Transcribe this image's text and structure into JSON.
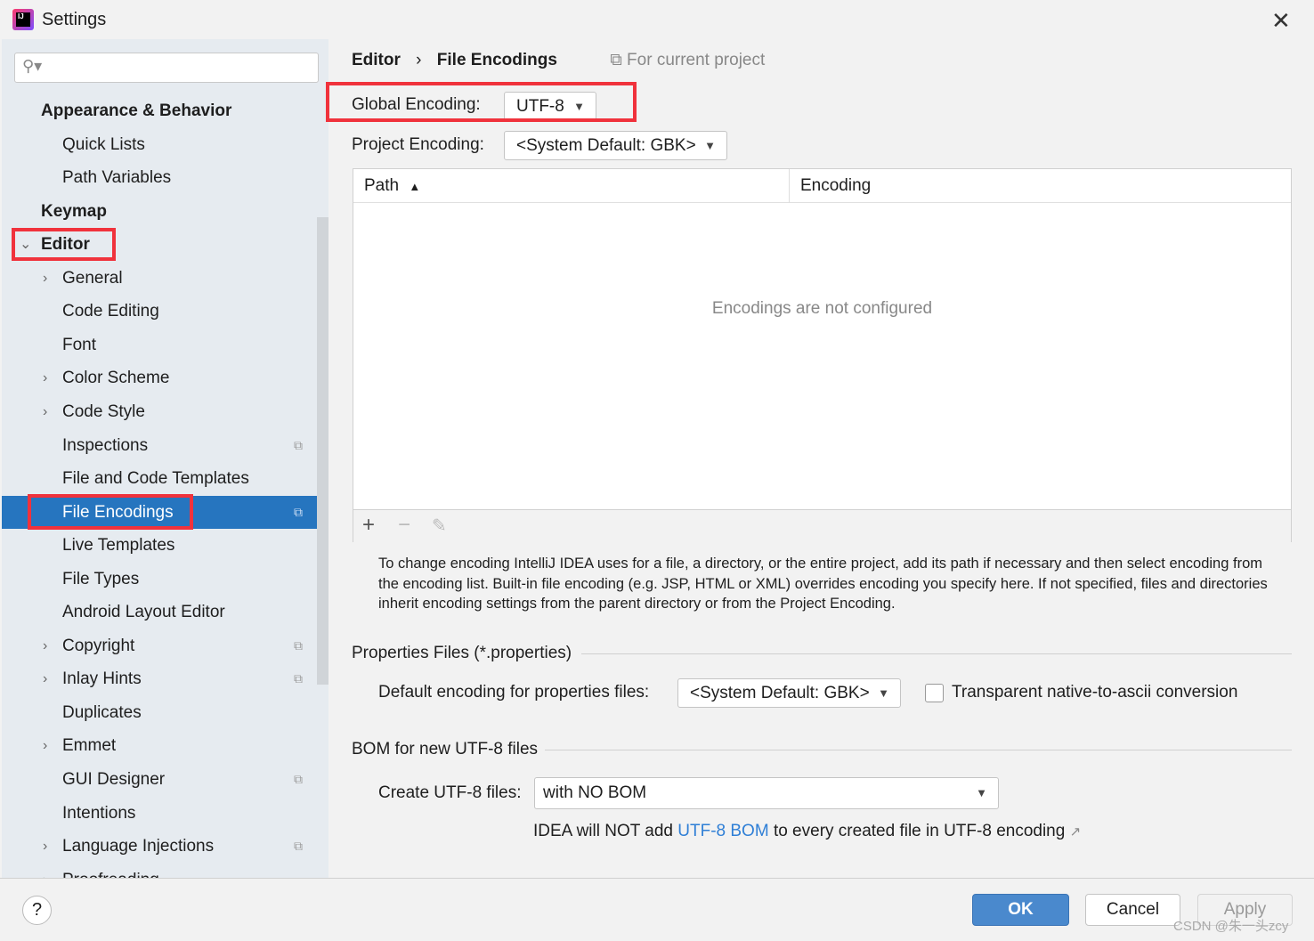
{
  "window": {
    "title": "Settings",
    "logo_text": "IJ"
  },
  "sidebar": {
    "search_placeholder": "",
    "items": [
      {
        "label": "Appearance & Behavior",
        "level": 0,
        "bold": true
      },
      {
        "label": "Quick Lists",
        "level": 1
      },
      {
        "label": "Path Variables",
        "level": 1
      },
      {
        "label": "Keymap",
        "level": 0,
        "bold": true
      },
      {
        "label": "Editor",
        "level": 0,
        "bold": true,
        "expanded": true
      },
      {
        "label": "General",
        "level": 1,
        "chevron": true
      },
      {
        "label": "Code Editing",
        "level": 1
      },
      {
        "label": "Font",
        "level": 1
      },
      {
        "label": "Color Scheme",
        "level": 1,
        "chevron": true
      },
      {
        "label": "Code Style",
        "level": 1,
        "chevron": true
      },
      {
        "label": "Inspections",
        "level": 1,
        "project": true
      },
      {
        "label": "File and Code Templates",
        "level": 1
      },
      {
        "label": "File Encodings",
        "level": 1,
        "project": true,
        "selected": true
      },
      {
        "label": "Live Templates",
        "level": 1
      },
      {
        "label": "File Types",
        "level": 1
      },
      {
        "label": "Android Layout Editor",
        "level": 1
      },
      {
        "label": "Copyright",
        "level": 1,
        "chevron": true,
        "project": true
      },
      {
        "label": "Inlay Hints",
        "level": 1,
        "chevron": true,
        "project": true
      },
      {
        "label": "Duplicates",
        "level": 1
      },
      {
        "label": "Emmet",
        "level": 1,
        "chevron": true
      },
      {
        "label": "GUI Designer",
        "level": 1,
        "project": true
      },
      {
        "label": "Intentions",
        "level": 1
      },
      {
        "label": "Language Injections",
        "level": 1,
        "chevron": true,
        "project": true
      },
      {
        "label": "Proofreading",
        "level": 1,
        "chevron": true
      }
    ]
  },
  "breadcrumb": {
    "parent": "Editor",
    "sep": "›",
    "current": "File Encodings",
    "scope": "For current project"
  },
  "global_encoding": {
    "label": "Global Encoding:",
    "value": "UTF-8"
  },
  "project_encoding": {
    "label": "Project Encoding:",
    "value": "<System Default: GBK>"
  },
  "table": {
    "columns": [
      "Path",
      "Encoding"
    ],
    "empty_text": "Encodings are not configured"
  },
  "help_text": "To change encoding IntelliJ IDEA uses for a file, a directory, or the entire project, add its path if necessary and then select encoding from the encoding list. Built-in file encoding (e.g. JSP, HTML or XML) overrides encoding you specify here. If not specified, files and directories inherit encoding settings from the parent directory or from the Project Encoding.",
  "properties": {
    "section": "Properties Files (*.properties)",
    "label": "Default encoding for properties files:",
    "value": "<System Default: GBK>",
    "checkbox_label": "Transparent native-to-ascii conversion",
    "checked": false
  },
  "bom": {
    "section": "BOM for new UTF-8 files",
    "label": "Create UTF-8 files:",
    "value": "with NO BOM",
    "note_before": "IDEA will NOT add",
    "note_link": "UTF-8 BOM",
    "note_after": "to every created file in UTF-8 encoding"
  },
  "footer": {
    "help": "?",
    "ok": "OK",
    "cancel": "Cancel",
    "apply": "Apply",
    "watermark": "CSDN @朱一头zcy"
  },
  "colors": {
    "accent": "#2675bf",
    "highlight": "#f0323c",
    "link": "#2f7fd6"
  }
}
